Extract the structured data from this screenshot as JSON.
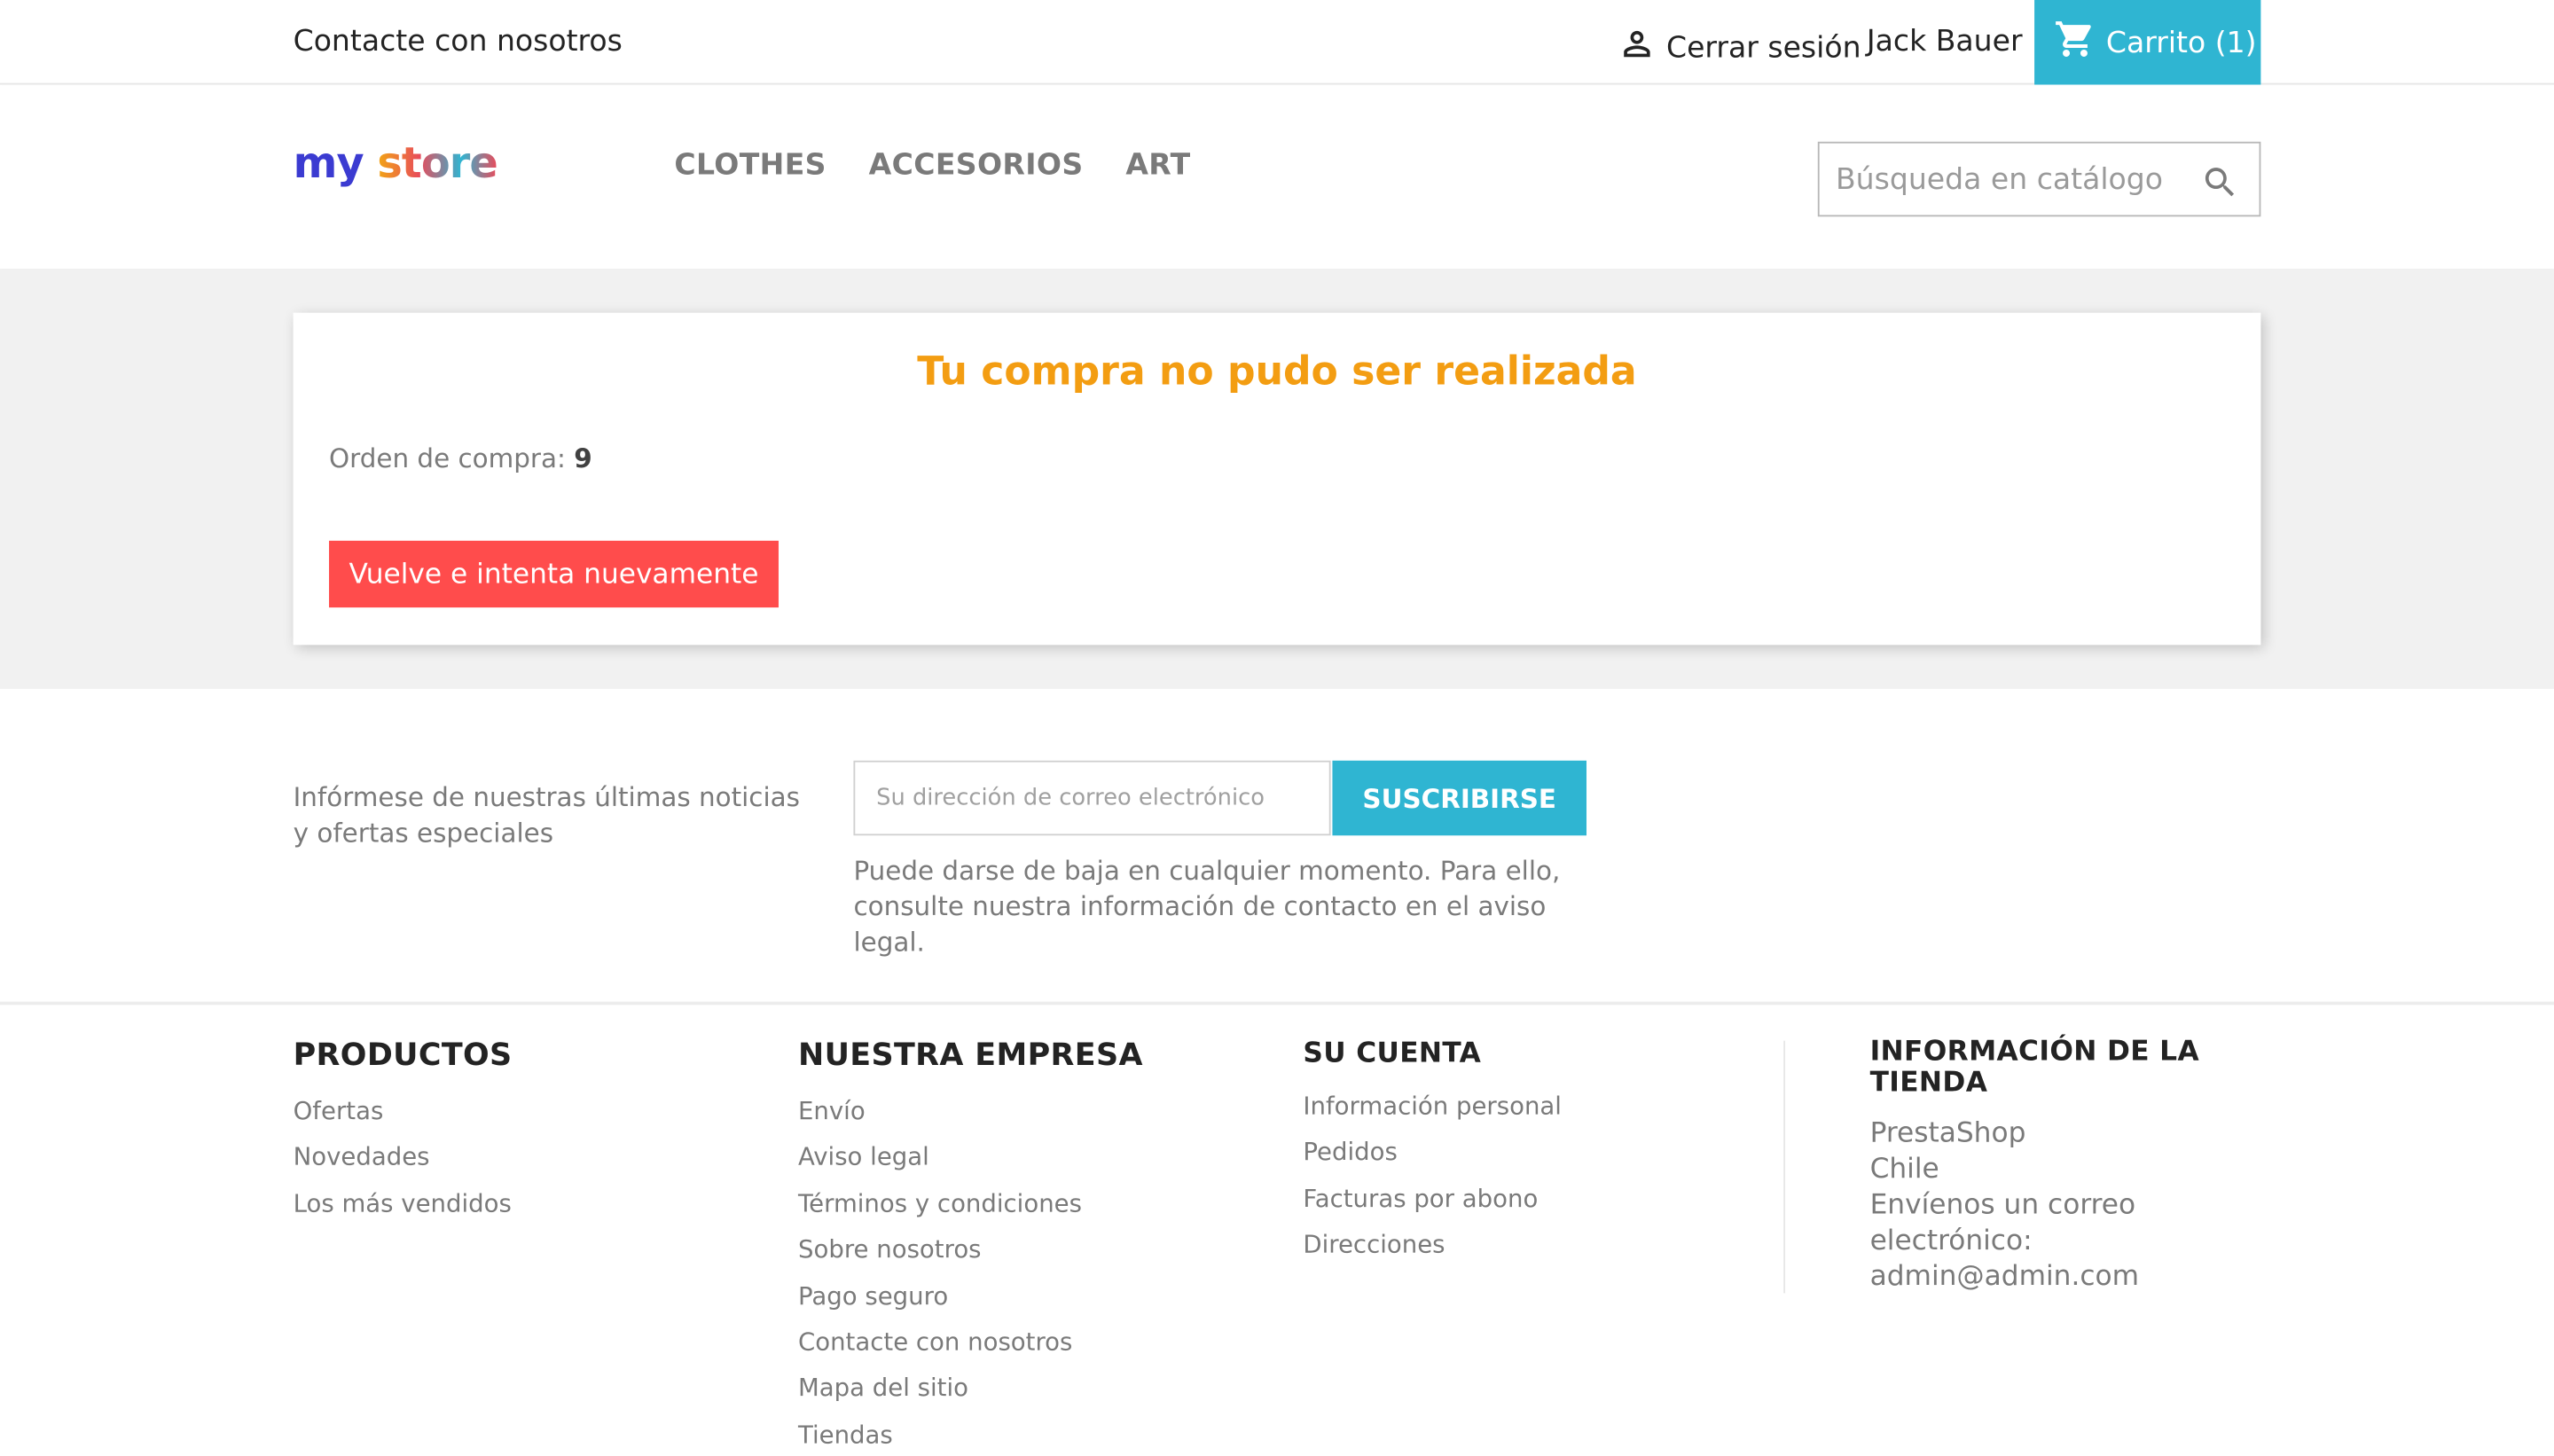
{
  "topbar": {
    "contact": "Contacte con nosotros",
    "logout": "Cerrar sesión",
    "user": "Jack Bauer",
    "cart": "Carrito (1)"
  },
  "header": {
    "logo": {
      "text_1": "my",
      "text_2": "store"
    },
    "menu": [
      "CLOTHES",
      "ACCESORIOS",
      "ART"
    ],
    "search_placeholder": "Búsqueda en catálogo"
  },
  "main": {
    "title": "Tu compra no pudo ser realizada",
    "order_label": "Orden de compra:",
    "order_number": "9",
    "retry_button": "Vuelve e intenta nuevamente"
  },
  "newsletter": {
    "text": "Infórmese de nuestras últimas noticias y ofertas especiales",
    "email_placeholder": "Su dirección de correo electrónico",
    "subscribe_button": "SUSCRIBIRSE",
    "note": "Puede darse de baja en cualquier momento. Para ello, consulte nuestra información de contacto en el aviso legal."
  },
  "footer": {
    "productos": {
      "title": "PRODUCTOS",
      "links": [
        "Ofertas",
        "Novedades",
        "Los más vendidos"
      ]
    },
    "empresa": {
      "title": "NUESTRA EMPRESA",
      "links": [
        "Envío",
        "Aviso legal",
        "Términos y condiciones",
        "Sobre nosotros",
        "Pago seguro",
        "Contacte con nosotros",
        "Mapa del sitio",
        "Tiendas"
      ]
    },
    "cuenta": {
      "title": "SU CUENTA",
      "links": [
        "Información personal",
        "Pedidos",
        "Facturas por abono",
        "Direcciones"
      ]
    },
    "tienda": {
      "title": "INFORMACIÓN DE LA TIENDA",
      "lines": [
        "PrestaShop",
        "Chile",
        "Envíenos un correo electrónico:",
        "admin@admin.com"
      ]
    }
  },
  "colors": {
    "accent": "#2fb5d2",
    "error_title": "#f39d12",
    "retry_button": "#ff4c4c",
    "main_background": "#f1f1f1"
  },
  "icons": {
    "user": "person-icon",
    "cart": "shopping-cart-icon",
    "search": "search-icon"
  }
}
